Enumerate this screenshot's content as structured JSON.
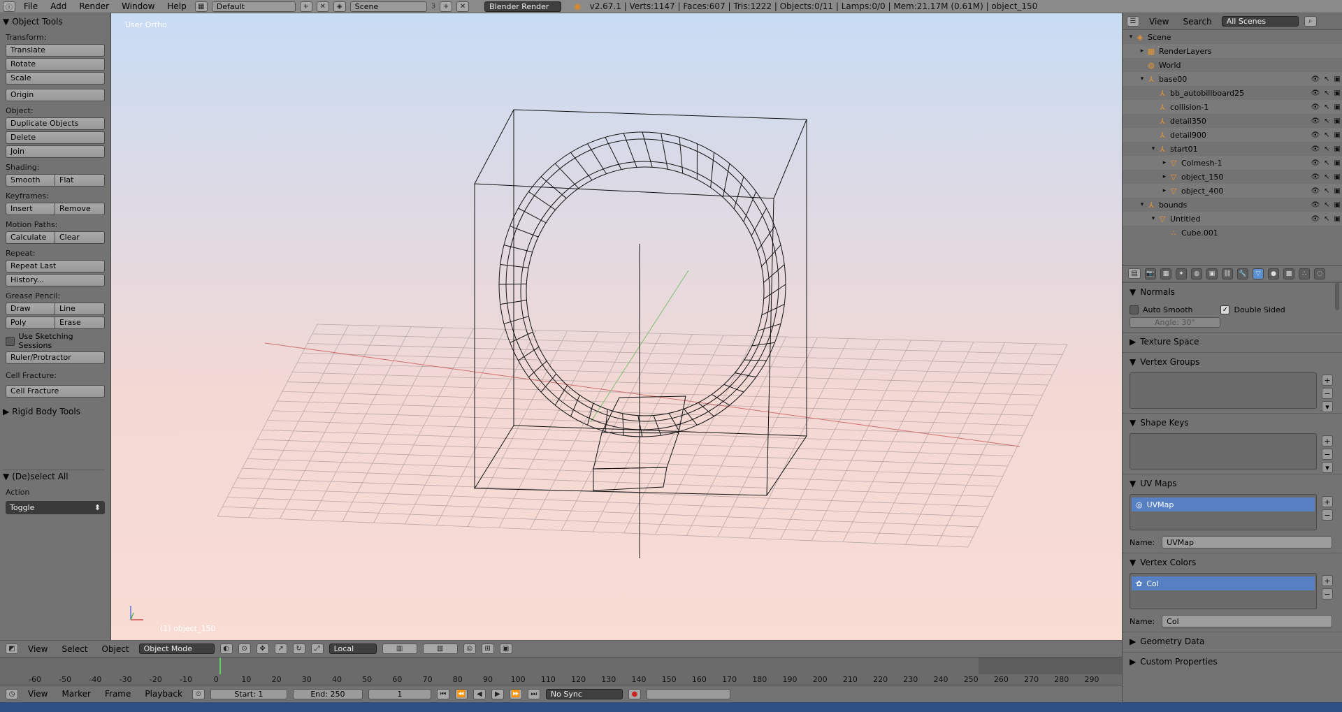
{
  "topbar": {
    "menus": [
      "File",
      "Add",
      "Render",
      "Window",
      "Help"
    ],
    "layout": "Default",
    "scene": "Scene",
    "scene_count": "3",
    "engine": "Blender Render",
    "stats": "v2.67.1 | Verts:1147 | Faces:607 | Tris:1222 | Objects:0/11 | Lamps:0/0 | Mem:21.17M (0.61M) | object_150"
  },
  "toolshelf": {
    "title": "Object Tools",
    "transform_label": "Transform:",
    "translate": "Translate",
    "rotate": "Rotate",
    "scale": "Scale",
    "origin": "Origin",
    "object_label": "Object:",
    "duplicate": "Duplicate Objects",
    "delete": "Delete",
    "join": "Join",
    "shading_label": "Shading:",
    "smooth": "Smooth",
    "flat": "Flat",
    "keyframes_label": "Keyframes:",
    "insert": "Insert",
    "remove": "Remove",
    "motion_label": "Motion Paths:",
    "calculate": "Calculate",
    "clear": "Clear",
    "repeat_label": "Repeat:",
    "repeat_last": "Repeat Last",
    "history": "History...",
    "grease_label": "Grease Pencil:",
    "draw": "Draw",
    "line": "Line",
    "poly": "Poly",
    "erase": "Erase",
    "sketching": "Use Sketching Sessions",
    "ruler": "Ruler/Protractor",
    "cell_label": "Cell Fracture:",
    "cell_fracture": "Cell Fracture",
    "rigid": "Rigid Body Tools",
    "deselect_title": "(De)select All",
    "action_label": "Action",
    "action_value": "Toggle"
  },
  "viewport": {
    "view_label": "User Ortho",
    "object_label": "(1) object_150"
  },
  "view3d_header": {
    "view": "View",
    "select": "Select",
    "object": "Object",
    "mode": "Object Mode",
    "pivot": "Local"
  },
  "timeline": {
    "ticks": [
      "-60",
      "-50",
      "-40",
      "-30",
      "-20",
      "-10",
      "0",
      "10",
      "20",
      "30",
      "40",
      "50",
      "60",
      "70",
      "80",
      "90",
      "100",
      "110",
      "120",
      "130",
      "140",
      "150",
      "160",
      "170",
      "180",
      "190",
      "200",
      "210",
      "220",
      "230",
      "240",
      "250",
      "260",
      "270",
      "280",
      "290"
    ],
    "view": "View",
    "marker": "Marker",
    "frame": "Frame",
    "playback": "Playback",
    "start": "Start: 1",
    "end": "End: 250",
    "current": "1",
    "sync": "No Sync"
  },
  "outliner": {
    "view": "View",
    "search": "Search",
    "filter": "All Scenes",
    "rows": [
      {
        "label": "Scene"
      },
      {
        "label": "RenderLayers"
      },
      {
        "label": "World"
      },
      {
        "label": "base00"
      },
      {
        "label": "bb_autobillboard25"
      },
      {
        "label": "collision-1"
      },
      {
        "label": "detail350"
      },
      {
        "label": "detail900"
      },
      {
        "label": "start01"
      },
      {
        "label": "Colmesh-1"
      },
      {
        "label": "object_150"
      },
      {
        "label": "object_400"
      },
      {
        "label": "bounds"
      },
      {
        "label": "Untitled"
      },
      {
        "label": "Cube.001"
      }
    ]
  },
  "properties": {
    "normals": "Normals",
    "auto_smooth": "Auto Smooth",
    "double_sided": "Double Sided",
    "angle": "Angle: 30°",
    "texture_space": "Texture Space",
    "vertex_groups": "Vertex Groups",
    "shape_keys": "Shape Keys",
    "uv_maps": "UV Maps",
    "uv_item": "UVMap",
    "name_label": "Name:",
    "uv_name": "UVMap",
    "vertex_colors": "Vertex Colors",
    "vc_item": "Col",
    "vc_name": "Col",
    "geometry_data": "Geometry Data",
    "custom_props": "Custom Properties"
  }
}
